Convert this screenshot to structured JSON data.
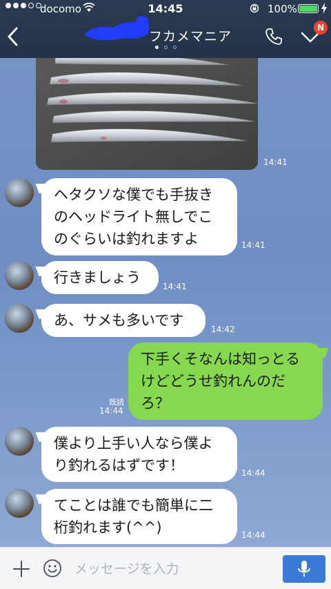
{
  "status_bar": {
    "carrier": "docomo",
    "time": "14:45",
    "battery": "100%",
    "battery_level": 1.0
  },
  "header": {
    "title": "フカメマニア",
    "notification_badge": "N",
    "page_indicator": {
      "count": 3,
      "active": 0
    }
  },
  "messages": [
    {
      "type": "image",
      "time": "14:41"
    },
    {
      "type": "text",
      "side": "in",
      "text_lines": [
        "ヘタクソな僕でも手抜き",
        "のヘッドライト無しでこ",
        "のぐらいは釣れますよ"
      ],
      "time": "14:41"
    },
    {
      "type": "text",
      "side": "in",
      "text_lines": [
        "行きましょう"
      ],
      "time": "14:41"
    },
    {
      "type": "text",
      "side": "in",
      "text_lines": [
        "あ、サメも多いです"
      ],
      "time": "14:42"
    },
    {
      "type": "text",
      "side": "out",
      "text_lines": [
        "下手くそなんは知っとる",
        "けどどうせ釣れんのだ",
        "ろ？"
      ],
      "read": "既読",
      "time": "14:44"
    },
    {
      "type": "text",
      "side": "in",
      "text_lines": [
        "僕より上手い人なら僕よ",
        "り釣れるはずです！"
      ],
      "time": "14:44"
    },
    {
      "type": "text",
      "side": "in",
      "text_lines": [
        "てことは誰でも簡単に二",
        "桁釣れます(^^)"
      ],
      "time": "14:44"
    }
  ],
  "input_bar": {
    "placeholder": "メッセージを入力"
  },
  "colors": {
    "header_bg": "#2b3a52",
    "chat_bg": "#7593c5",
    "outgoing_bubble": "#86d84f",
    "incoming_bubble": "#ffffff",
    "badge": "#e8452c",
    "mic_button": "#3b7bd8"
  },
  "icons": [
    "back-icon",
    "phone-icon",
    "menu-chevron-icon",
    "plus-icon",
    "emoji-icon",
    "mic-icon",
    "wifi-icon",
    "lock-rotation-icon",
    "battery-icon",
    "charging-icon"
  ]
}
